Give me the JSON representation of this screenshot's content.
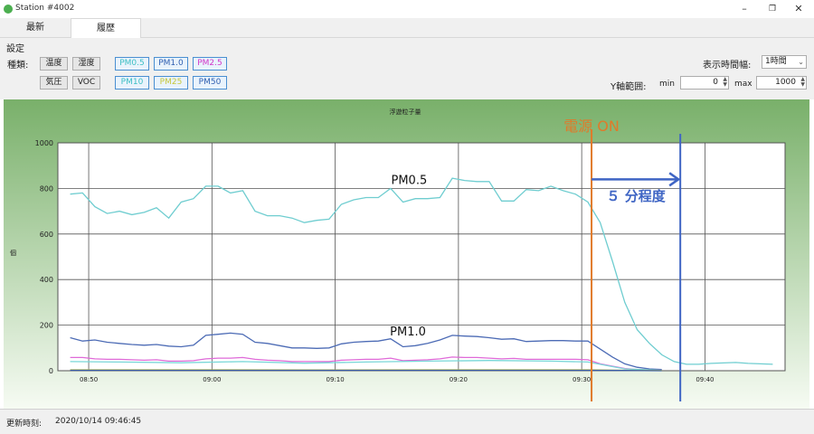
{
  "window": {
    "title": "Station #4002",
    "minimize": "–",
    "maximize": "❐",
    "close": "✕"
  },
  "tabs": [
    {
      "label": "最新",
      "active": false
    },
    {
      "label": "履歴",
      "active": true
    }
  ],
  "settings": {
    "group_label": "設定",
    "type_label": "種類:",
    "buttons_row1": [
      "温度",
      "湿度"
    ],
    "buttons_row2": [
      "気圧",
      "VOC"
    ],
    "pm_row1": [
      {
        "label": "PM0.5",
        "color": "#3dbfc4"
      },
      {
        "label": "PM1.0",
        "color": "#2f5fb0"
      },
      {
        "label": "PM2.5",
        "color": "#d236c8"
      }
    ],
    "pm_row2": [
      {
        "label": "PM10",
        "color": "#3dbfc4"
      },
      {
        "label": "PM25",
        "color": "#c7c83a"
      },
      {
        "label": "PM50",
        "color": "#2f5fb0"
      }
    ],
    "time_range_label": "表示時間幅:",
    "time_range_value": "1時間",
    "y_range_label": "Y軸範囲:",
    "min_label": "min",
    "min_value": "0",
    "max_label": "max",
    "max_value": "1000"
  },
  "status": {
    "label": "更新時刻:",
    "value": "2020/10/14 09:46:45"
  },
  "chart_data": {
    "type": "line",
    "title": "浮遊粒子量",
    "ylabel": "個",
    "xlabel": "",
    "ylim": [
      0,
      1000
    ],
    "yticks": [
      0,
      200,
      400,
      600,
      800,
      1000
    ],
    "xlim": [
      0,
      59
    ],
    "xticks": [
      {
        "t": 2.5,
        "label": "08:50"
      },
      {
        "t": 12.5,
        "label": "09:00"
      },
      {
        "t": 22.5,
        "label": "09:10"
      },
      {
        "t": 32.5,
        "label": "09:20"
      },
      {
        "t": 42.5,
        "label": "09:30"
      },
      {
        "t": 52.5,
        "label": "09:40"
      }
    ],
    "grid": true,
    "background": "#ffffff",
    "frame_gradient": [
      "#79b06a",
      "#f6fbf3"
    ],
    "series": [
      {
        "name": "PM0.5",
        "color": "#6fcdd0",
        "x": [
          1,
          2,
          3,
          4,
          5,
          6,
          7,
          8,
          9,
          10,
          11,
          12,
          13,
          14,
          15,
          16,
          17,
          18,
          19,
          20,
          21,
          22,
          23,
          24,
          25,
          26,
          27,
          28,
          29,
          30,
          31,
          32,
          33,
          34,
          35,
          36,
          37,
          38,
          39,
          40,
          41,
          42,
          43,
          44,
          45,
          46,
          47,
          48,
          49,
          50,
          51,
          52,
          53,
          54,
          55,
          56,
          57,
          58
        ],
        "values": [
          775,
          780,
          720,
          690,
          700,
          685,
          695,
          715,
          670,
          740,
          755,
          810,
          810,
          780,
          790,
          700,
          680,
          680,
          670,
          650,
          660,
          665,
          730,
          750,
          760,
          760,
          800,
          740,
          755,
          755,
          760,
          845,
          835,
          830,
          830,
          745,
          745,
          795,
          790,
          810,
          790,
          775,
          740,
          650,
          480,
          300,
          180,
          120,
          70,
          40,
          28,
          28,
          32,
          34,
          36,
          32,
          30,
          28
        ]
      },
      {
        "name": "PM1.0",
        "color": "#4c6bb5",
        "x": [
          1,
          2,
          3,
          4,
          5,
          6,
          7,
          8,
          9,
          10,
          11,
          12,
          13,
          14,
          15,
          16,
          17,
          18,
          19,
          20,
          21,
          22,
          23,
          24,
          25,
          26,
          27,
          28,
          29,
          30,
          31,
          32,
          33,
          34,
          35,
          36,
          37,
          38,
          39,
          40,
          41,
          42,
          43,
          44,
          45,
          46,
          47,
          48,
          49
        ],
        "values": [
          145,
          130,
          135,
          125,
          120,
          115,
          112,
          115,
          108,
          105,
          112,
          155,
          160,
          165,
          160,
          125,
          120,
          110,
          100,
          100,
          98,
          100,
          118,
          125,
          128,
          130,
          140,
          105,
          110,
          120,
          135,
          155,
          152,
          150,
          145,
          138,
          140,
          128,
          130,
          132,
          132,
          130,
          130,
          95,
          60,
          30,
          15,
          8,
          5
        ]
      },
      {
        "name": "PM2.5",
        "color": "#df6ad8",
        "x": [
          1,
          2,
          3,
          4,
          5,
          6,
          7,
          8,
          9,
          10,
          11,
          12,
          13,
          14,
          15,
          16,
          17,
          18,
          19,
          20,
          21,
          22,
          23,
          24,
          25,
          26,
          27,
          28,
          29,
          30,
          31,
          32,
          33,
          34,
          35,
          36,
          37,
          38,
          39,
          40,
          41,
          42,
          43,
          44,
          45,
          46,
          47,
          48,
          49
        ],
        "values": [
          58,
          58,
          52,
          50,
          50,
          48,
          46,
          48,
          42,
          42,
          44,
          52,
          55,
          55,
          58,
          50,
          46,
          44,
          40,
          40,
          40,
          40,
          46,
          48,
          50,
          50,
          55,
          44,
          46,
          48,
          52,
          60,
          58,
          58,
          55,
          52,
          54,
          50,
          50,
          50,
          50,
          50,
          48,
          30,
          20,
          10,
          5,
          3,
          2
        ]
      },
      {
        "name": "PM10",
        "color": "#78d7d8",
        "x": [
          1,
          5,
          10,
          15,
          20,
          25,
          30,
          35,
          40,
          43,
          46,
          49
        ],
        "values": [
          40,
          38,
          35,
          40,
          33,
          38,
          42,
          45,
          42,
          38,
          8,
          2
        ]
      },
      {
        "name": "PM25",
        "color": "#c8c93c",
        "x": [
          1,
          10,
          20,
          30,
          40,
          43,
          46,
          49
        ],
        "values": [
          4,
          4,
          3,
          4,
          4,
          4,
          2,
          1
        ]
      },
      {
        "name": "PM50",
        "color": "#3a5da8",
        "x": [
          1,
          10,
          20,
          30,
          40,
          43,
          46,
          49
        ],
        "values": [
          2,
          2,
          2,
          2,
          2,
          2,
          1,
          0
        ]
      }
    ],
    "series_labels": [
      {
        "text": "PM0.5",
        "t": 28.5,
        "v": 820
      },
      {
        "text": "PM1.0",
        "t": 28.4,
        "v": 155
      }
    ],
    "annotations": {
      "power_on": {
        "text": "電源 ON",
        "t": 43.3,
        "color": "#e07a2a"
      },
      "five_min": {
        "text": "５ 分程度",
        "t_from": 43.3,
        "t_to": 50.5,
        "color": "#3f65c4",
        "arrow_v": 840,
        "label_v": 770
      }
    }
  }
}
